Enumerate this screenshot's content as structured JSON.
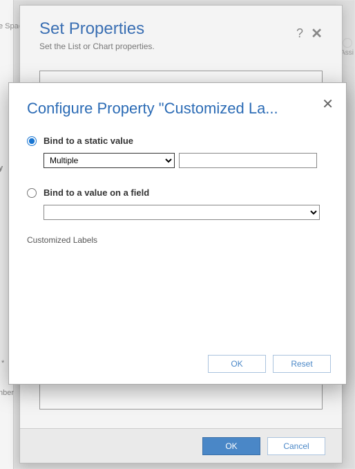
{
  "bg": {
    "spac_label": "e Spac",
    "y_label": "y",
    "star": "*",
    "nber": "nber",
    "assi": "Assi"
  },
  "outer": {
    "title": "Set Properties",
    "subtitle": "Set the List or Chart properties.",
    "help": "?",
    "close": "✕",
    "ok": "OK",
    "cancel": "Cancel"
  },
  "inner": {
    "title": "Configure Property \"Customized La...",
    "close": "✕",
    "option1_label": "Bind to a static value",
    "option2_label": "Bind to a value on a field",
    "static_select_value": "Multiple",
    "static_text_value": "",
    "field_select_value": "",
    "property_name": "Customized Labels",
    "ok": "OK",
    "reset": "Reset"
  }
}
